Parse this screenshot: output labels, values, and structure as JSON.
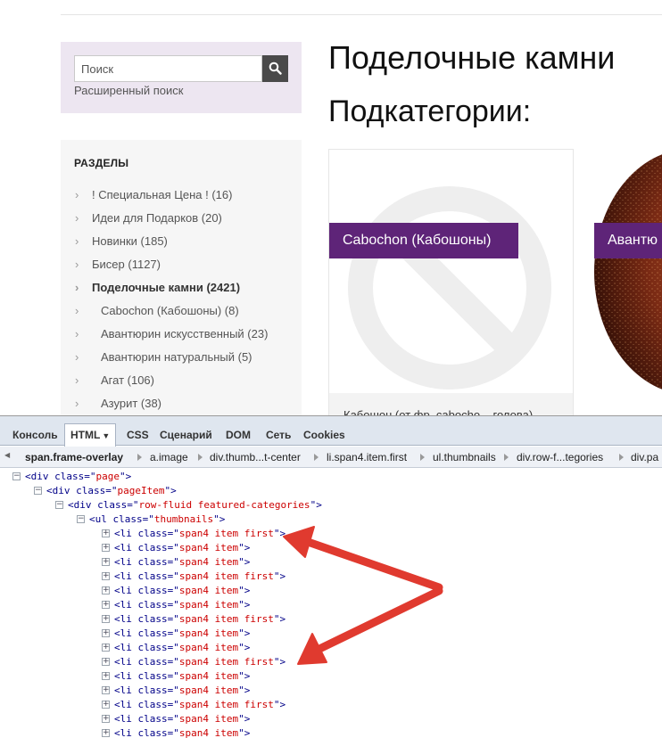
{
  "sidebar": {
    "search_placeholder": "Поиск",
    "advanced_search": "Расширенный поиск",
    "sections_title": "РАЗДЕЛЫ",
    "categories": [
      {
        "label": "! Специальная Цена ! (16)",
        "level": 0,
        "active": false
      },
      {
        "label": "Идеи для Подарков (20)",
        "level": 0,
        "active": false
      },
      {
        "label": "Новинки (185)",
        "level": 0,
        "active": false
      },
      {
        "label": "Бисер (1127)",
        "level": 0,
        "active": false
      },
      {
        "label": "Поделочные камни (2421)",
        "level": 0,
        "active": true
      },
      {
        "label": "Cabochon (Кабошоны) (8)",
        "level": 1,
        "active": false
      },
      {
        "label": "Авантюрин искусственный (23)",
        "level": 1,
        "active": false
      },
      {
        "label": "Авантюрин натуральный (5)",
        "level": 1,
        "active": false
      },
      {
        "label": "Агат (106)",
        "level": 1,
        "active": false
      },
      {
        "label": "Азурит (38)",
        "level": 1,
        "active": false
      }
    ]
  },
  "main": {
    "title": "Поделочные камни",
    "subtitle": "Подкатегории:",
    "cards": [
      {
        "label": "Cabochon (Кабошоны)",
        "description": "Кабошон (от фр. cabocho... голова)"
      },
      {
        "label": "Авантю"
      }
    ]
  },
  "devtools": {
    "tabs": [
      "Консоль",
      "HTML",
      "CSS",
      "Сценарий",
      "DOM",
      "Сеть",
      "Cookies"
    ],
    "active_tab": "HTML",
    "breadcrumbs": [
      "span.frame-overlay",
      "a.image",
      "div.thumb...t-center",
      "li.span4.item.first",
      "ul.thumbnails",
      "div.row-f...tegories",
      "div.pa"
    ],
    "tree": [
      {
        "expander": "minus",
        "tag": "div",
        "attr": "class",
        "value": "page",
        "close": ">"
      },
      {
        "expander": "minus",
        "tag": "div",
        "attr": "class",
        "value": "pageItem",
        "close": ">"
      },
      {
        "expander": "minus",
        "tag": "div",
        "attr": "class",
        "value": "row-fluid featured-categories",
        "close": ">"
      },
      {
        "expander": "minus",
        "tag": "ul",
        "attr": "class",
        "value": "thumbnails",
        "close": ">"
      },
      {
        "expander": "plus",
        "tag": "li",
        "attr": "class",
        "value": "span4 item first",
        "close": ">"
      },
      {
        "expander": "plus",
        "tag": "li",
        "attr": "class",
        "value": "span4 item",
        "close": ">"
      },
      {
        "expander": "plus",
        "tag": "li",
        "attr": "class",
        "value": "span4 item",
        "close": ">"
      },
      {
        "expander": "plus",
        "tag": "li",
        "attr": "class",
        "value": "span4 item first",
        "close": ">"
      },
      {
        "expander": "plus",
        "tag": "li",
        "attr": "class",
        "value": "span4 item",
        "close": ">"
      },
      {
        "expander": "plus",
        "tag": "li",
        "attr": "class",
        "value": "span4 item",
        "close": ">"
      },
      {
        "expander": "plus",
        "tag": "li",
        "attr": "class",
        "value": "span4 item first",
        "close": ">"
      },
      {
        "expander": "plus",
        "tag": "li",
        "attr": "class",
        "value": "span4 item",
        "close": ">"
      },
      {
        "expander": "plus",
        "tag": "li",
        "attr": "class",
        "value": "span4 item",
        "close": ">"
      },
      {
        "expander": "plus",
        "tag": "li",
        "attr": "class",
        "value": "span4 item first",
        "close": ">"
      },
      {
        "expander": "plus",
        "tag": "li",
        "attr": "class",
        "value": "span4 item",
        "close": ">"
      },
      {
        "expander": "plus",
        "tag": "li",
        "attr": "class",
        "value": "span4 item",
        "close": ">"
      },
      {
        "expander": "plus",
        "tag": "li",
        "attr": "class",
        "value": "span4 item first",
        "close": ">"
      },
      {
        "expander": "plus",
        "tag": "li",
        "attr": "class",
        "value": "span4 item",
        "close": ">"
      },
      {
        "expander": "plus",
        "tag": "li",
        "attr": "class",
        "value": "span4 item",
        "close": ">"
      }
    ]
  },
  "colors": {
    "brand_purple": "#5e2478",
    "sidebar_bg": "#ede6f1",
    "annotation_arrow": "#e03a2f",
    "code_tag": "#000088",
    "code_value": "#cc0000"
  }
}
